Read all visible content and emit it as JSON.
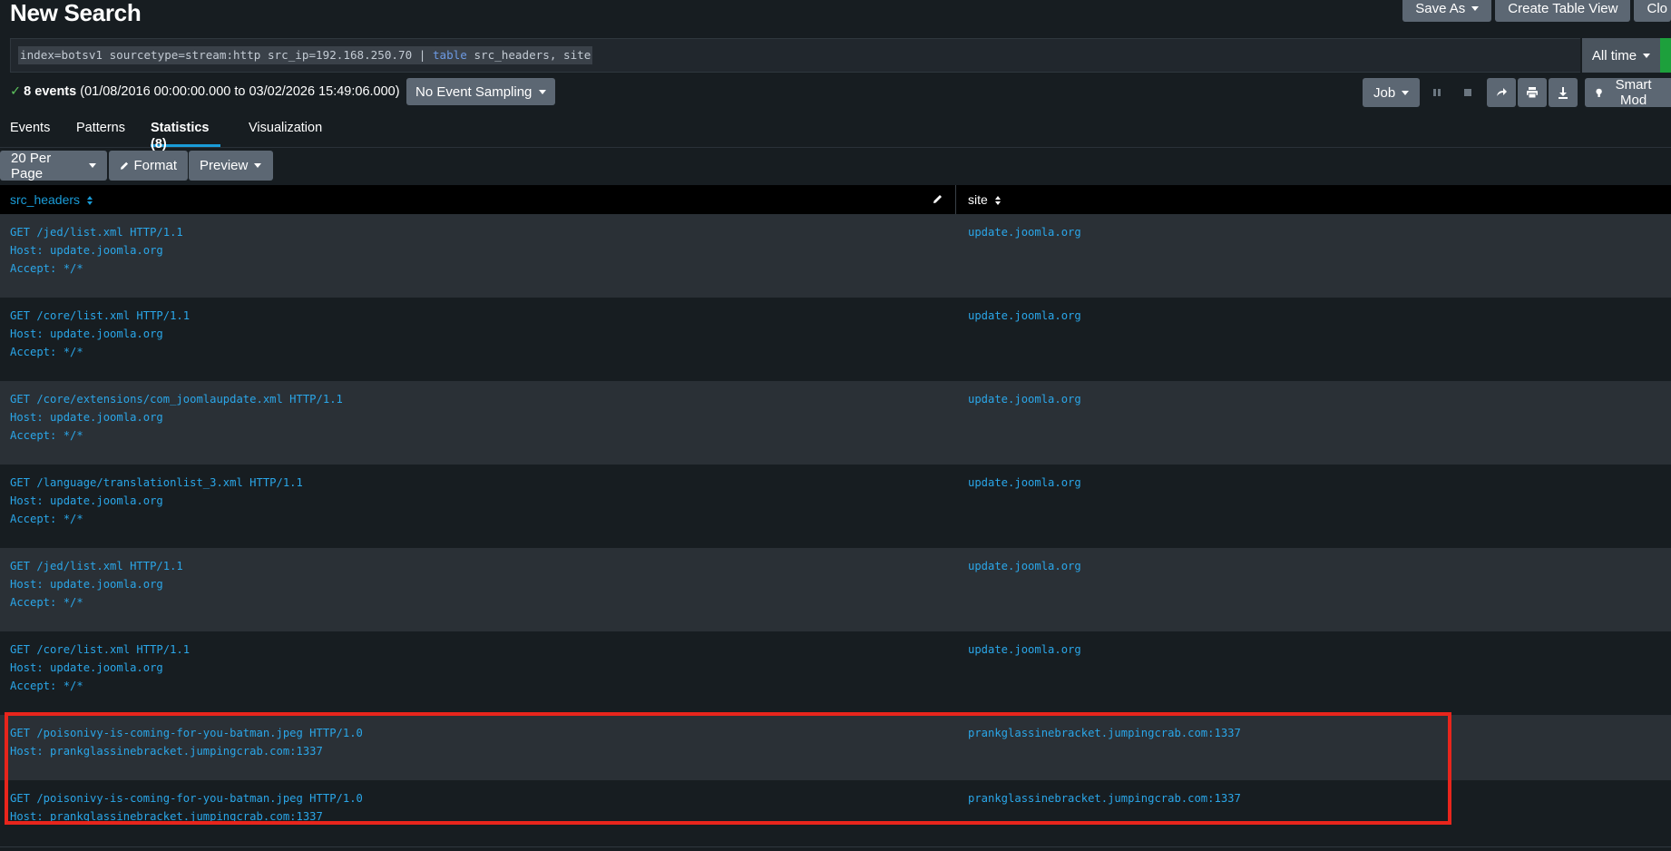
{
  "page": {
    "title": "New Search"
  },
  "top_actions": [
    {
      "label": "Save As",
      "dropdown": true
    },
    {
      "label": "Create Table View",
      "dropdown": false
    },
    {
      "label": "Clo",
      "dropdown": false
    }
  ],
  "search": {
    "query_prefix": "index=botsv1 sourcetype=stream:http src_ip=192.168.250.70 | ",
    "query_command": "table",
    "query_suffix": " src_headers, site",
    "time_range": "All time"
  },
  "status": {
    "events": "8 events",
    "range": "(01/08/2016 00:00:00.000 to 03/02/2026 15:49:06.000)",
    "sampling": "No Event Sampling"
  },
  "job_controls": {
    "job_label": "Job",
    "smart_mode": "Smart Mod",
    "icons": [
      "pause-icon",
      "stop-icon",
      "share-icon",
      "print-icon",
      "download-icon",
      "bulb-icon"
    ]
  },
  "tabs": [
    {
      "label": "Events",
      "active": false
    },
    {
      "label": "Patterns",
      "active": false
    },
    {
      "label": "Statistics (8)",
      "active": true
    },
    {
      "label": "Visualization",
      "active": false
    }
  ],
  "table_controls": {
    "per_page": "20 Per Page",
    "format": "Format",
    "preview": "Preview"
  },
  "table": {
    "columns": [
      "src_headers",
      "site"
    ],
    "rows": [
      {
        "src_headers": [
          "GET /jed/list.xml HTTP/1.1",
          "Host: update.joomla.org",
          "Accept: */*"
        ],
        "site": "update.joomla.org"
      },
      {
        "src_headers": [
          "GET /core/list.xml HTTP/1.1",
          "Host: update.joomla.org",
          "Accept: */*"
        ],
        "site": "update.joomla.org"
      },
      {
        "src_headers": [
          "GET /core/extensions/com_joomlaupdate.xml HTTP/1.1",
          "Host: update.joomla.org",
          "Accept: */*"
        ],
        "site": "update.joomla.org"
      },
      {
        "src_headers": [
          "GET /language/translationlist_3.xml HTTP/1.1",
          "Host: update.joomla.org",
          "Accept: */*"
        ],
        "site": "update.joomla.org"
      },
      {
        "src_headers": [
          "GET /jed/list.xml HTTP/1.1",
          "Host: update.joomla.org",
          "Accept: */*"
        ],
        "site": "update.joomla.org"
      },
      {
        "src_headers": [
          "GET /core/list.xml HTTP/1.1",
          "Host: update.joomla.org",
          "Accept: */*"
        ],
        "site": "update.joomla.org"
      },
      {
        "src_headers": [
          "GET /poisonivy-is-coming-for-you-batman.jpeg HTTP/1.0",
          "Host: prankglassinebracket.jumpingcrab.com:1337"
        ],
        "site": "prankglassinebracket.jumpingcrab.com:1337"
      },
      {
        "src_headers": [
          "GET /poisonivy-is-coming-for-you-batman.jpeg HTTP/1.0",
          "Host: prankglassinebracket.jumpingcrab.com:1337"
        ],
        "site": "prankglassinebracket.jumpingcrab.com:1337"
      }
    ]
  },
  "colors": {
    "background": "#171d21",
    "row_alt": "#2a3036",
    "link": "#2aa6e8",
    "accent_tab": "#1a9cd8",
    "highlight_box": "#e8251c",
    "run_button": "#1da03c"
  }
}
